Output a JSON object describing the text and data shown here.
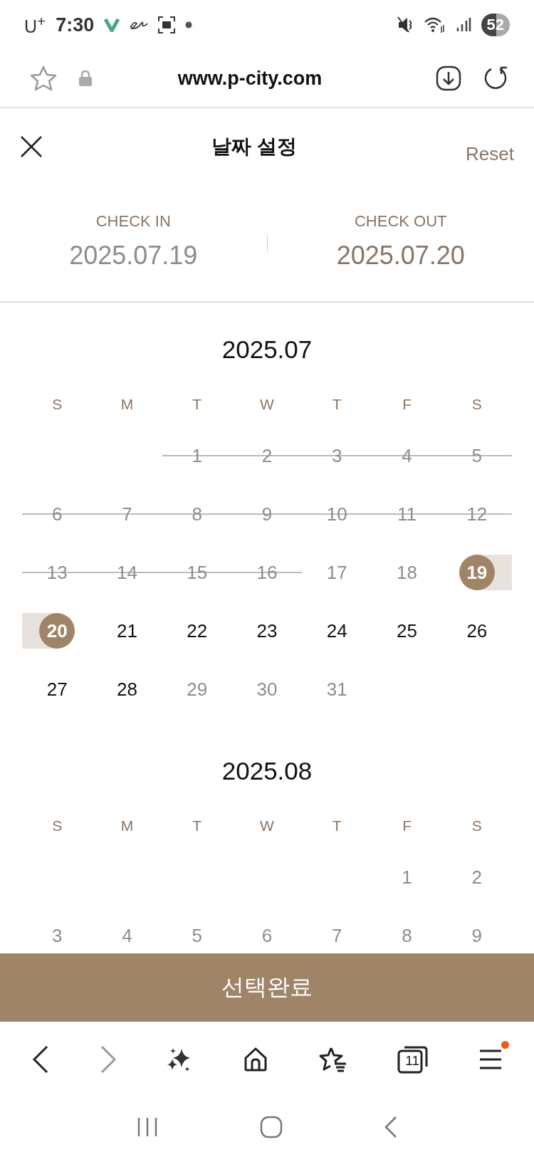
{
  "status_bar": {
    "carrier": "U$^{+}$",
    "time": "7:30",
    "battery": "52"
  },
  "address_bar": {
    "url": "www.p-city.com"
  },
  "header": {
    "title": "날짜 설정",
    "reset": "Reset"
  },
  "dates": {
    "check_in": {
      "label": "CHECK IN",
      "value": "2025.07.19"
    },
    "check_out": {
      "label": "CHECK OUT",
      "value": "2025.07.20"
    }
  },
  "months": [
    {
      "title": "2025.07",
      "weekdays": [
        "S",
        "M",
        "T",
        "W",
        "T",
        "F",
        "S"
      ],
      "weeks": [
        [
          {
            "kind": "empty"
          },
          {
            "kind": "empty"
          },
          {
            "day": "1",
            "kind": "struck",
            "selected": false
          },
          {
            "day": "2",
            "kind": "struck",
            "selected": false
          },
          {
            "day": "3",
            "kind": "struck",
            "selected": false
          },
          {
            "day": "4",
            "kind": "struck",
            "selected": false
          },
          {
            "day": "5",
            "kind": "struck",
            "selected": false
          }
        ],
        [
          {
            "day": "6",
            "kind": "struck",
            "selected": false
          },
          {
            "day": "7",
            "kind": "struck",
            "selected": false
          },
          {
            "day": "8",
            "kind": "struck",
            "selected": false
          },
          {
            "day": "9",
            "kind": "struck",
            "selected": false
          },
          {
            "day": "10",
            "kind": "struck",
            "selected": false
          },
          {
            "day": "11",
            "kind": "struck",
            "selected": false
          },
          {
            "day": "12",
            "kind": "struck",
            "selected": false
          }
        ],
        [
          {
            "day": "13",
            "kind": "struck",
            "selected": false
          },
          {
            "day": "14",
            "kind": "struck",
            "selected": false
          },
          {
            "day": "15",
            "kind": "struck",
            "selected": false
          },
          {
            "day": "16",
            "kind": "struck",
            "selected": false
          },
          {
            "day": "17",
            "kind": "muted",
            "selected": false
          },
          {
            "day": "18",
            "kind": "muted",
            "selected": false
          },
          {
            "day": "19",
            "kind": "normal",
            "selected": true,
            "range_start": true,
            "range_end": false
          }
        ],
        [
          {
            "day": "20",
            "kind": "normal",
            "selected": true,
            "range_start": false,
            "range_end": true
          },
          {
            "day": "21",
            "kind": "normal",
            "selected": false
          },
          {
            "day": "22",
            "kind": "normal",
            "selected": false
          },
          {
            "day": "23",
            "kind": "normal",
            "selected": false
          },
          {
            "day": "24",
            "kind": "normal",
            "selected": false
          },
          {
            "day": "25",
            "kind": "normal",
            "selected": false
          },
          {
            "day": "26",
            "kind": "normal",
            "selected": false
          }
        ],
        [
          {
            "day": "27",
            "kind": "normal",
            "selected": false
          },
          {
            "day": "28",
            "kind": "normal",
            "selected": false
          },
          {
            "day": "29",
            "kind": "muted",
            "selected": false
          },
          {
            "day": "30",
            "kind": "muted",
            "selected": false
          },
          {
            "day": "31",
            "kind": "muted",
            "selected": false
          },
          {
            "kind": "empty"
          },
          {
            "kind": "empty"
          }
        ]
      ]
    },
    {
      "title": "2025.08",
      "weekdays": [
        "S",
        "M",
        "T",
        "W",
        "T",
        "F",
        "S"
      ],
      "weeks": [
        [
          {
            "kind": "empty"
          },
          {
            "kind": "empty"
          },
          {
            "kind": "empty"
          },
          {
            "kind": "empty"
          },
          {
            "kind": "empty"
          },
          {
            "day": "1",
            "kind": "muted",
            "selected": false
          },
          {
            "day": "2",
            "kind": "muted",
            "selected": false
          }
        ],
        [
          {
            "day": "3",
            "kind": "muted",
            "selected": false
          },
          {
            "day": "4",
            "kind": "muted",
            "selected": false
          },
          {
            "day": "5",
            "kind": "muted",
            "selected": false
          },
          {
            "day": "6",
            "kind": "muted",
            "selected": false
          },
          {
            "day": "7",
            "kind": "muted",
            "selected": false
          },
          {
            "day": "8",
            "kind": "muted",
            "selected": false
          },
          {
            "day": "9",
            "kind": "muted",
            "selected": false
          }
        ]
      ]
    }
  ],
  "confirm_button": "선택완료",
  "toolbar": [
    {
      "kind": "back"
    },
    {
      "kind": "forward"
    },
    {
      "kind": "sparkle"
    },
    {
      "kind": "home"
    },
    {
      "kind": "bookmarks"
    },
    {
      "kind": "tabs",
      "label": "11"
    },
    {
      "kind": "menu",
      "badge": true
    }
  ]
}
